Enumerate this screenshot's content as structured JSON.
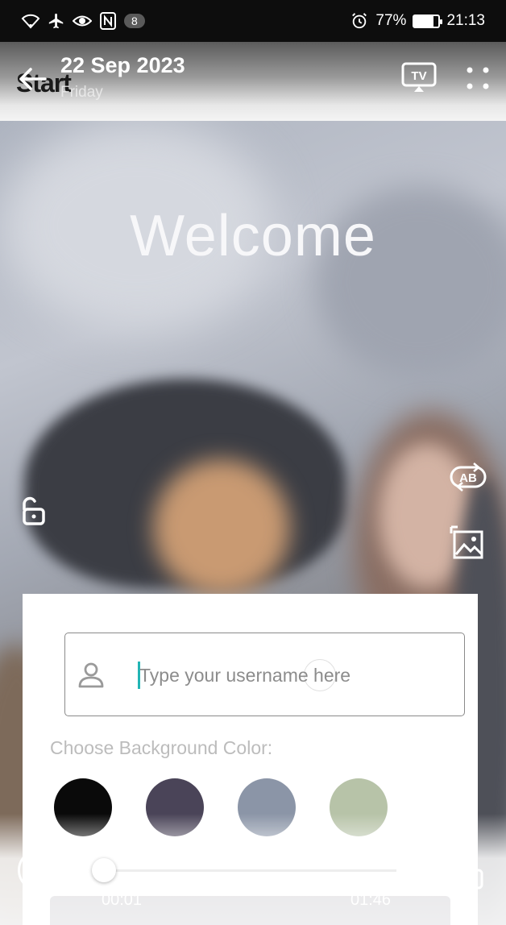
{
  "status_bar": {
    "notification_count": "8",
    "battery_percent": "77%",
    "battery_level": 0.77,
    "time": "21:13",
    "icons": [
      "wifi-icon",
      "airplane-icon",
      "eye-icon",
      "nfc-icon",
      "alarm-icon",
      "battery-icon"
    ]
  },
  "header": {
    "back_text": "Start",
    "date": "22 Sep 2023",
    "day": "Friday",
    "cast_label": "TV",
    "icons": [
      "back-arrow-icon",
      "tv-cast-icon",
      "more-dots-icon"
    ]
  },
  "overlay": {
    "welcome": "Welcome",
    "ab_label": "AB",
    "icons": [
      "unlock-icon",
      "ab-swap-icon",
      "image-icon"
    ]
  },
  "form": {
    "username_placeholder": "Type your username here",
    "username_value": "",
    "color_label": "Choose Background Color:",
    "colors": [
      "#0a0a0a",
      "#4a4458",
      "#8b95a7",
      "#b7c3a8"
    ]
  },
  "player": {
    "current_time": "00:01",
    "total_time": "01:46",
    "progress": 0.01,
    "icons": [
      "pause-icon",
      "rotate-screen-icon"
    ]
  }
}
